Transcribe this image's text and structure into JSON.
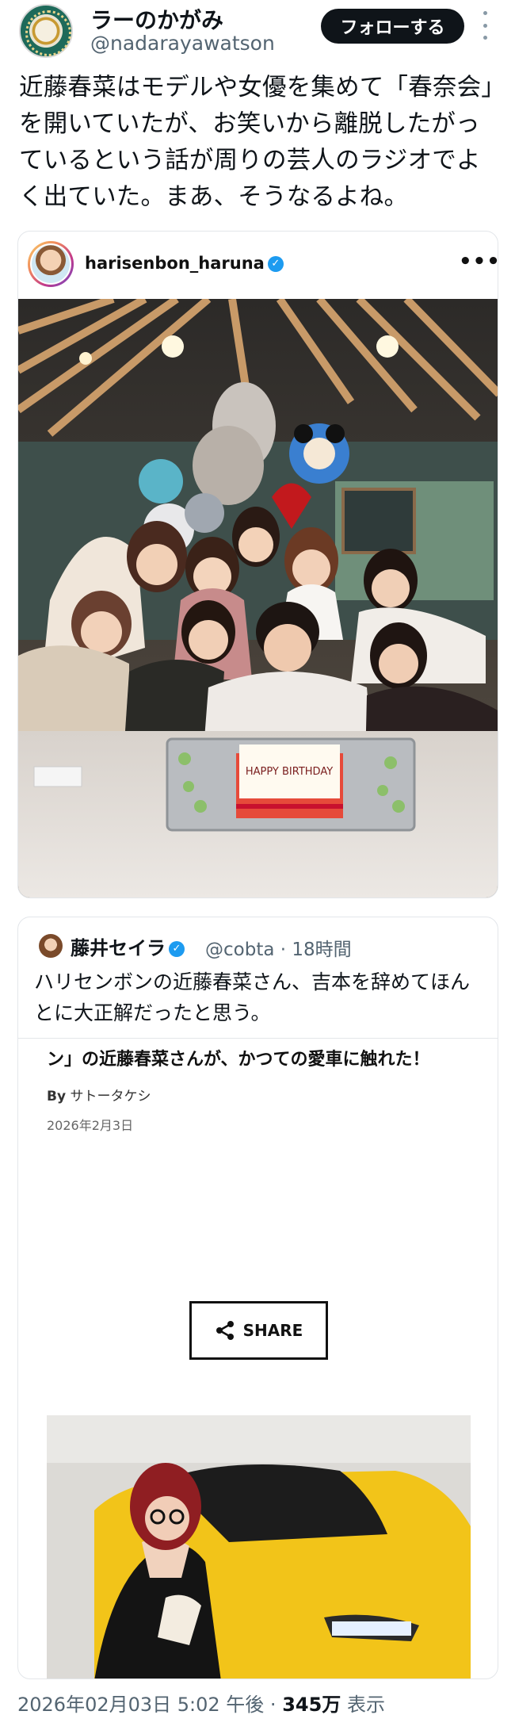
{
  "author": {
    "display_name": "ラーのかがみ",
    "handle": "@nadarayawatson",
    "follow_label": "フォローする"
  },
  "tweet": {
    "text": "近藤春菜はモデルや女優を集めて「春奈会」を開いていたが、お笑いから離脱したがっているという話が周りの芸人のラジオでよく出ていた。まあ、そうなるよね。"
  },
  "instagram_embed": {
    "username": "harisenbon_haruna",
    "more_label": "•••",
    "photo_cake_text": "HAPPY BIRTHDAY"
  },
  "quote_tweet": {
    "name": "藤井セイラ",
    "handle": "@cobta",
    "time": "· 18時間",
    "text": "ハリセンボンの近藤春菜さん、吉本を辞めてほんとに大正解だったと思う。",
    "article": {
      "headline": "ン」の近藤春菜さんが、かつての愛車に触れた！",
      "byline_prefix": "By",
      "byline_author": "サトータケシ",
      "date": "2026年2月3日",
      "share_label": "SHARE"
    }
  },
  "meta": {
    "timestamp": "2026年02月03日 5:02 午後 · ",
    "views_count": "345万",
    "views_label": " 表示"
  },
  "colors": {
    "follow_bg": "#0f1419",
    "verified": "#1d9bf0",
    "car_yellow": "#f2c419",
    "secondary_text": "#536471"
  }
}
